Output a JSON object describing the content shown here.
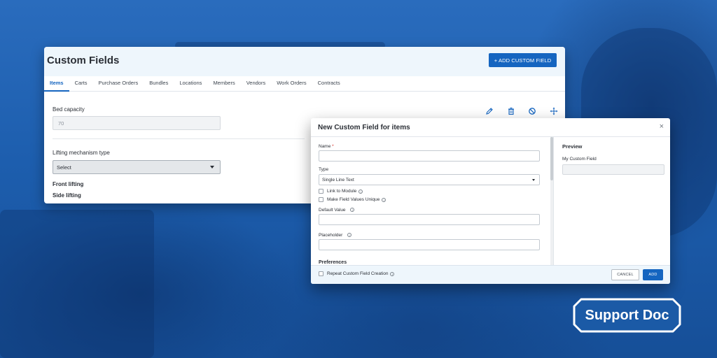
{
  "panel": {
    "title": "Custom Fields",
    "add_button_label": "+ ADD CUSTOM FIELD",
    "tabs": [
      {
        "label": "Items",
        "active": true
      },
      {
        "label": "Carts",
        "active": false
      },
      {
        "label": "Purchase Orders",
        "active": false
      },
      {
        "label": "Bundles",
        "active": false
      },
      {
        "label": "Locations",
        "active": false
      },
      {
        "label": "Members",
        "active": false
      },
      {
        "label": "Vendors",
        "active": false
      },
      {
        "label": "Work Orders",
        "active": false
      },
      {
        "label": "Contracts",
        "active": false
      }
    ],
    "fields": {
      "bed_capacity_label": "Bed capacity",
      "bed_capacity_value": "70",
      "lifting_label": "Lifting mechanism type",
      "lifting_select_value": "Select",
      "option_1": "Front lifting",
      "option_2": "Side lifting"
    },
    "action_icons": [
      "pencil-icon",
      "trash-icon",
      "ban-icon",
      "move-icon"
    ]
  },
  "modal": {
    "title": "New Custom Field for items",
    "close_glyph": "×",
    "name_label": "Name",
    "required_mark": "*",
    "type_label": "Type",
    "type_value": "Single Line Text",
    "link_to_module_label": "Link to Module",
    "unique_label": "Make Field Values Unique",
    "default_value_label": "Default Value",
    "placeholder_label": "Placeholder",
    "preferences_label": "Preferences",
    "repeat_label": "Repeat Custom Field Creation",
    "info_glyph": "i",
    "preview_title": "Preview",
    "preview_field_label": "My Custom Field",
    "cancel_label": "CANCEL",
    "add_label": "ADD"
  },
  "badge": {
    "label": "Support Doc"
  },
  "colors": {
    "accent": "#1565c0",
    "background": "#1c5fae",
    "header_tint": "#eef6fc"
  }
}
